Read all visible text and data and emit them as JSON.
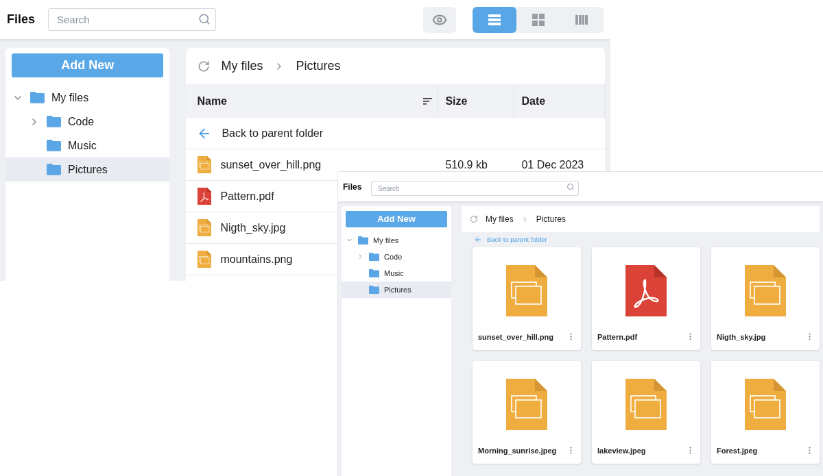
{
  "list_view_screenshot": {
    "title": "Files",
    "search": {
      "placeholder": "Search"
    },
    "view_modes": [
      {
        "kind": "list",
        "selected": true
      },
      {
        "kind": "grid",
        "selected": false
      },
      {
        "kind": "columns",
        "selected": false
      }
    ],
    "add_button": "Add New",
    "tree": [
      {
        "label": "My files",
        "expanded": true,
        "selected": false,
        "children": [
          {
            "label": "Code",
            "expanded": false,
            "selected": false
          },
          {
            "label": "Music",
            "selected": false
          },
          {
            "label": "Pictures",
            "selected": true
          }
        ]
      }
    ],
    "breadcrumb": [
      "My files",
      "Pictures"
    ],
    "table": {
      "columns": [
        "Name",
        "Size",
        "Date"
      ],
      "back_row": "Back to parent folder",
      "rows": [
        {
          "name": "sunset_over_hill.png",
          "kind": "image",
          "size": "510.9 kb",
          "date": "01 Dec 2023"
        },
        {
          "name": "Pattern.pdf",
          "kind": "pdf"
        },
        {
          "name": "Nigth_sky.jpg",
          "kind": "image"
        },
        {
          "name": "mountains.png",
          "kind": "image"
        }
      ]
    }
  },
  "grid_view_screenshot": {
    "title": "Files",
    "search": {
      "placeholder": "Search"
    },
    "add_button": "Add New",
    "tree": [
      {
        "label": "My files",
        "expanded": true,
        "selected": false,
        "children": [
          {
            "label": "Code",
            "expanded": false,
            "selected": false
          },
          {
            "label": "Music",
            "selected": false
          },
          {
            "label": "Pictures",
            "selected": true
          }
        ]
      }
    ],
    "breadcrumb": [
      "My files",
      "Pictures"
    ],
    "back_link": "Back to parent folder",
    "cards": [
      {
        "name": "sunset_over_hill.png",
        "kind": "image"
      },
      {
        "name": "Pattern.pdf",
        "kind": "pdf"
      },
      {
        "name": "Nigth_sky.jpg",
        "kind": "image"
      },
      {
        "name": "Morning_sunrise.jpeg",
        "kind": "image"
      },
      {
        "name": "lakeview.jpeg",
        "kind": "image"
      },
      {
        "name": "Forest.jpeg",
        "kind": "image"
      }
    ]
  }
}
